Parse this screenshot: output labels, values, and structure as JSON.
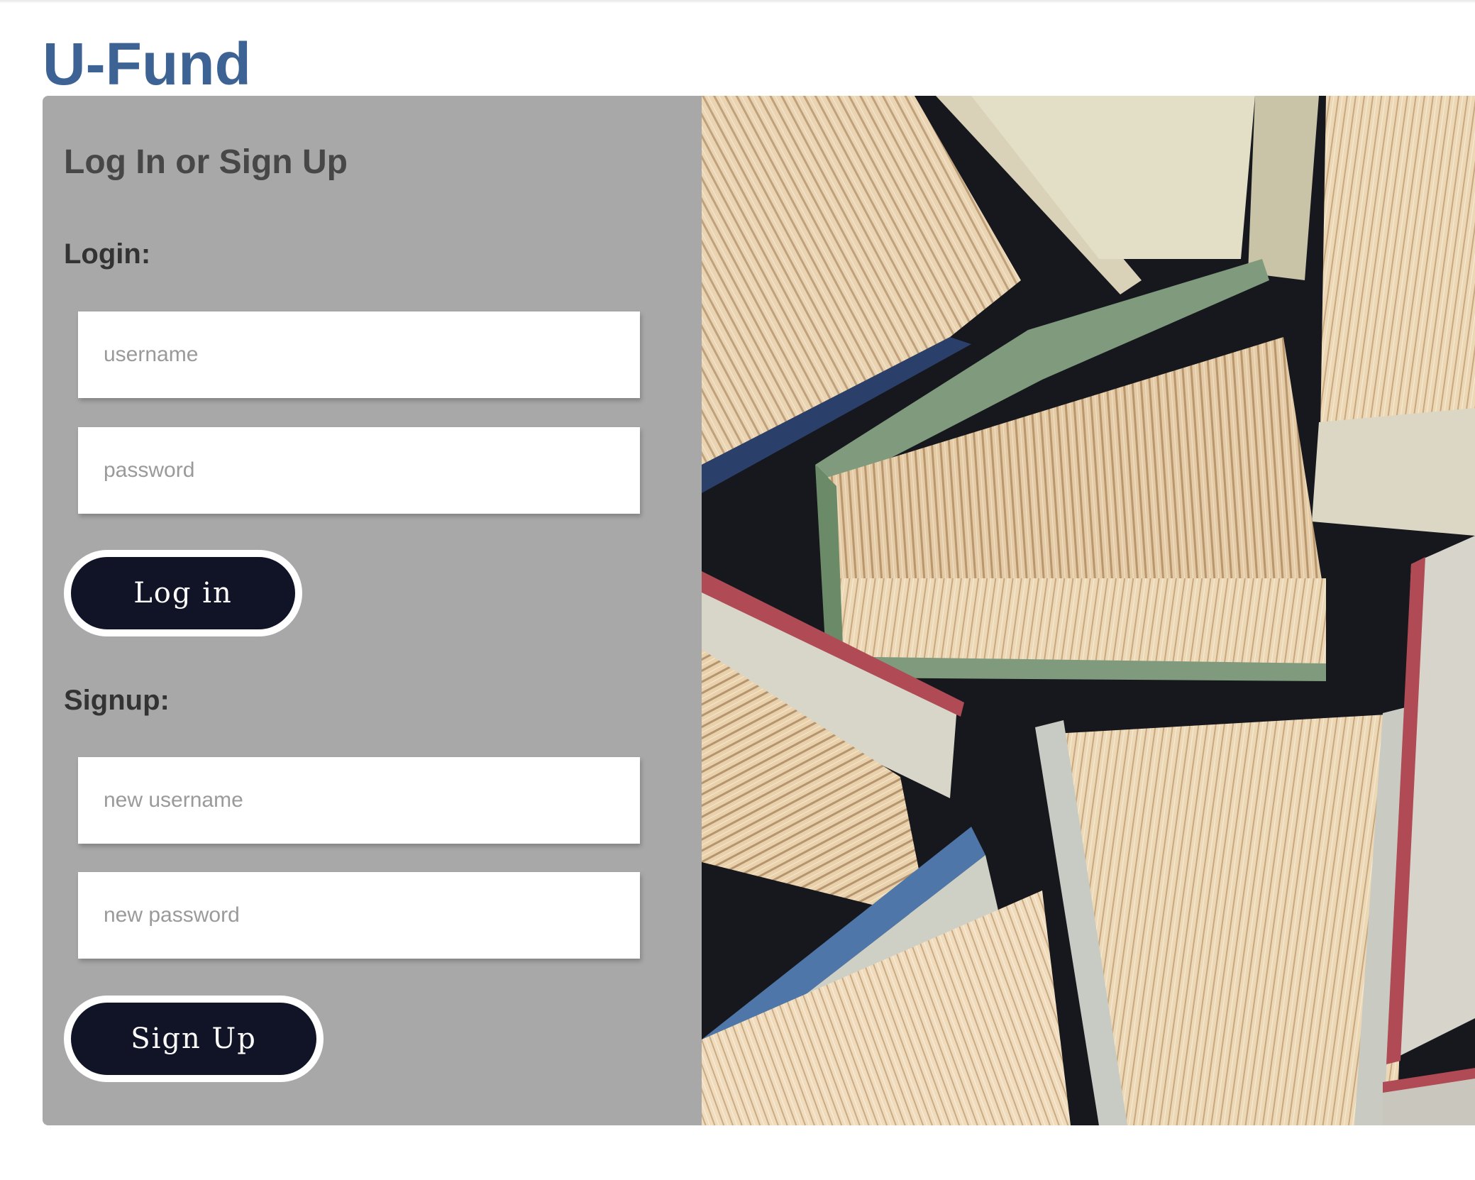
{
  "brand": {
    "title": "U-Fund",
    "color": "#3d6394"
  },
  "auth_panel": {
    "title": "Log In or Sign Up",
    "background": "#a8a8a8",
    "login": {
      "label": "Login:",
      "username_placeholder": "username",
      "password_placeholder": "password",
      "submit_label": "Log in"
    },
    "signup": {
      "label": "Signup:",
      "username_placeholder": "new username",
      "password_placeholder": "new password",
      "submit_label": "Sign Up"
    },
    "button_color": "#111427"
  },
  "hero_image": {
    "subject": "books-photo"
  }
}
